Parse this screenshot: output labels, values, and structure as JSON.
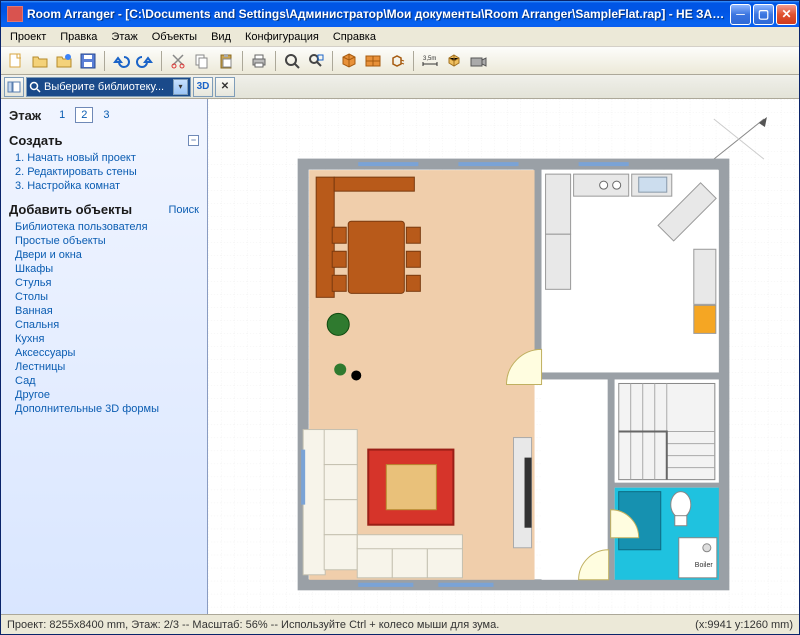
{
  "title": "Room Arranger - [C:\\Documents and Settings\\Администратор\\Мои документы\\Room Arranger\\SampleFlat.rap] - НЕ ЗАРЕГИСТРИРО...",
  "menu": [
    "Проект",
    "Правка",
    "Этаж",
    "Объекты",
    "Вид",
    "Конфигурация",
    "Справка"
  ],
  "sidebar": {
    "floor_label": "Этаж",
    "floors": [
      "1",
      "2",
      "3"
    ],
    "active_floor": "2",
    "create": {
      "title": "Создать",
      "items": [
        "1. Начать новый проект",
        "2. Редактировать стены",
        "3. Настройка комнат"
      ]
    },
    "addobjects": {
      "title": "Добавить объекты",
      "search": "Поиск",
      "items": [
        "Библиотека пользователя",
        "Простые объекты",
        "Двери и окна",
        "Шкафы",
        "Стулья",
        "Столы",
        "Ванная",
        "Спальня",
        "Кухня",
        "Аксессуары",
        "Лестницы",
        "Сад",
        "Другое",
        "Дополнительные 3D формы"
      ]
    }
  },
  "subtoolbar": {
    "search_placeholder": "Выберите библиотеку...",
    "btn3d": "3D"
  },
  "status": {
    "left": "Проект: 8255x8400 mm, Этаж: 2/3 -- Масштаб: 56% -- Используйте Ctrl + колесо мыши для зума.",
    "right": "(x:9941 y:1260 mm)"
  },
  "measure_label": "3,5m"
}
